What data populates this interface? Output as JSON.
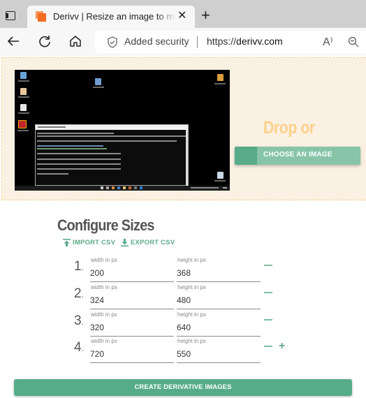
{
  "browser": {
    "tab_title": "Derivv | Resize an image to multiple sizes",
    "new_tab_symbol": "+",
    "close_symbol": "✕",
    "security_label": "Added security",
    "url_scheme": "https://",
    "url_host": "derivv.com",
    "read_aloud_symbol": "A⁾"
  },
  "dropzone": {
    "prompt": "Drop or",
    "choose_button_label": "CHOOSE AN IMAGE",
    "upload_progress": 0.18,
    "preview_alt": "Uploaded screenshot of Windows desktop with Command Prompt"
  },
  "configure": {
    "title": "Configure Sizes",
    "import_label": "IMPORT CSV",
    "export_label": "EXPORT CSV",
    "width_label": "width in px",
    "height_label": "height in px",
    "sizes": [
      {
        "index": "1",
        "width": "200",
        "height": "368"
      },
      {
        "index": "2",
        "width": "324",
        "height": "480"
      },
      {
        "index": "3",
        "width": "320",
        "height": "640"
      },
      {
        "index": "4",
        "width": "720",
        "height": "550"
      }
    ],
    "remove_symbol": "−",
    "add_symbol": "+"
  },
  "actions": {
    "create_label": "CREATE DERIVATIVE IMAGES"
  },
  "colors": {
    "accent_green": "#56ac88",
    "light_green": "#87c4a8",
    "drop_bg": "#fbf1e3",
    "drop_text": "#fdd08a"
  }
}
